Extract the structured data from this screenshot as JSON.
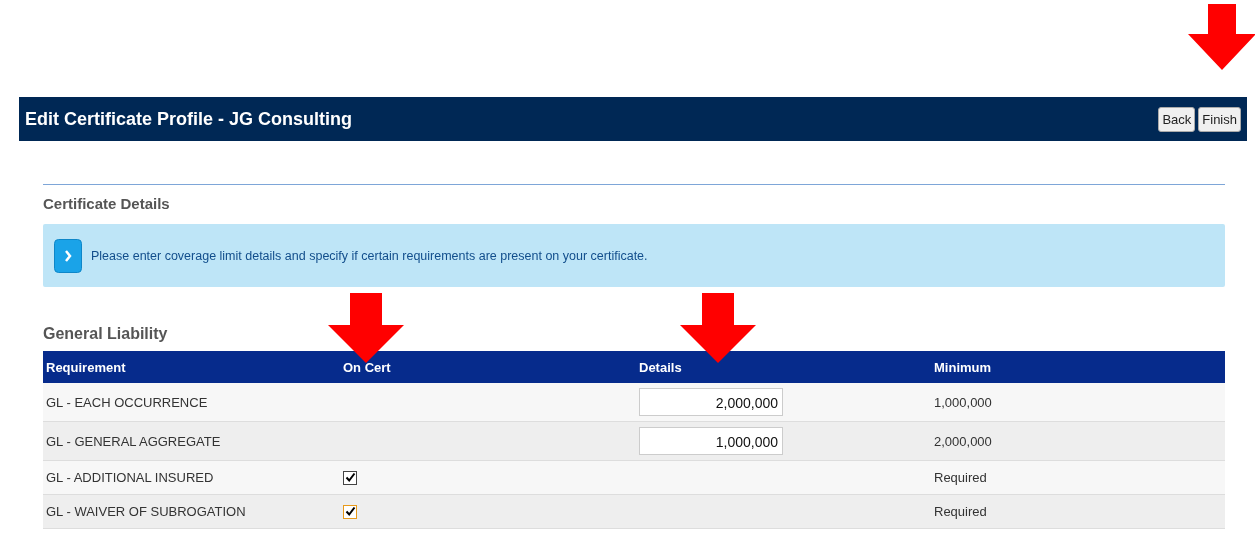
{
  "header": {
    "title": "Edit Certificate Profile - JG Consulting",
    "buttons": [
      "Back",
      "Finish"
    ]
  },
  "section_title": "Certificate Details",
  "info": {
    "message": "Please enter coverage limit details and specify if certain requirements are present on your certificate."
  },
  "table": {
    "title": "General Liability",
    "columns": [
      "Requirement",
      "On Cert",
      "Details",
      "Minimum"
    ],
    "rows": [
      {
        "kind": "input",
        "requirement": "GL - EACH OCCURRENCE",
        "details": "2,000,000",
        "minimum": "1,000,000"
      },
      {
        "kind": "input",
        "requirement": "GL - GENERAL AGGREGATE",
        "details": "1,000,000",
        "minimum": "2,000,000"
      },
      {
        "kind": "checkbox",
        "requirement": "GL - ADDITIONAL INSURED",
        "checked": true,
        "focused": false,
        "minimum": "Required"
      },
      {
        "kind": "checkbox",
        "requirement": "GL - WAIVER OF SUBROGATION",
        "checked": true,
        "focused": true,
        "minimum": "Required"
      }
    ]
  }
}
